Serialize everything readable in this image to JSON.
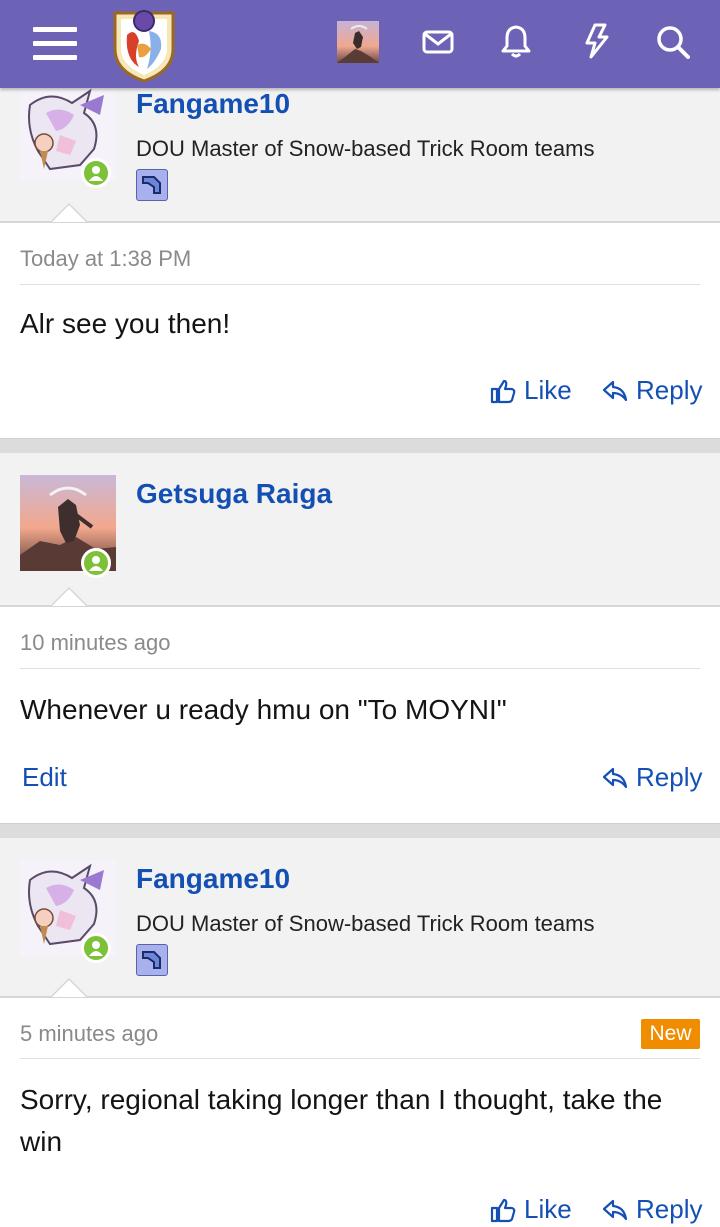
{
  "header": {
    "menu_icon": "hamburger-menu-icon",
    "logo": "site-logo",
    "inbox_icon": "envelope-icon",
    "alerts_icon": "bell-icon",
    "whats_new_icon": "lightning-bolt-icon",
    "search_icon": "search-icon",
    "bar_color": "#6d63b6"
  },
  "posts": [
    {
      "username": "Fangame10",
      "user_title": "DOU Master of Snow-based Trick Room teams",
      "timestamp": "Today at 1:38 PM",
      "body": "Alr see you then!",
      "like_label": "Like",
      "reply_label": "Reply"
    },
    {
      "username": "Getsuga Raiga",
      "timestamp": "10 minutes ago",
      "body": "Whenever u ready hmu on \"To MOYNI\"",
      "edit_label": "Edit",
      "reply_label": "Reply"
    },
    {
      "username": "Fangame10",
      "user_title": "DOU Master of Snow-based Trick Room teams",
      "timestamp": "5 minutes ago",
      "new_label": "New",
      "body": "Sorry, regional taking longer than I thought, take the win",
      "like_label": "Like",
      "reply_label": "Reply"
    }
  ],
  "colors": {
    "link": "#1450b4",
    "online": "#7cc138",
    "new_badge": "#f08c00"
  }
}
